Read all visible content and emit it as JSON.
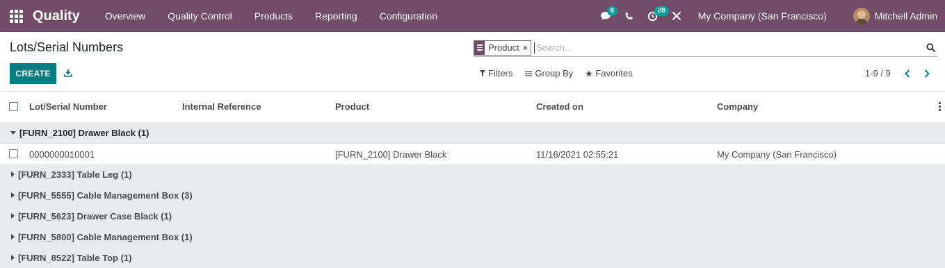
{
  "navbar": {
    "brand": "Quality",
    "menu": [
      "Overview",
      "Quality Control",
      "Products",
      "Reporting",
      "Configuration"
    ],
    "messages_count": "6",
    "activities_count": "28",
    "company": "My Company (San Francisco)",
    "user": "Mitchell Admin",
    "colors": {
      "navbar_bg": "#714b67",
      "badge": "#00a09d"
    }
  },
  "control_panel": {
    "title": "Lots/Serial Numbers",
    "create_label": "CREATE",
    "search": {
      "facet": "Product",
      "placeholder": "Search..."
    },
    "filters_label": "Filters",
    "group_by_label": "Group By",
    "favorites_label": "Favorites",
    "pager": "1-9 / 9",
    "colors": {
      "primary_button": "#017e84"
    }
  },
  "list": {
    "columns": [
      "Lot/Serial Number",
      "Internal Reference",
      "Product",
      "Created on",
      "Company"
    ],
    "groups": [
      {
        "label": "[FURN_2100] Drawer Black (1)",
        "expanded": true
      },
      {
        "label": "[FURN_2333] Table Leg (1)",
        "expanded": false
      },
      {
        "label": "[FURN_5555] Cable Management Box (3)",
        "expanded": false
      },
      {
        "label": "[FURN_5623] Drawer Case Black (1)",
        "expanded": false
      },
      {
        "label": "[FURN_5800] Cable Management Box (1)",
        "expanded": false
      },
      {
        "label": "[FURN_8522] Table Top (1)",
        "expanded": false
      }
    ],
    "record": {
      "lot": "0000000010001",
      "internal_reference": "",
      "product": "[FURN_2100] Drawer Black",
      "created_on": "11/16/2021 02:55:21",
      "company": "My Company (San Francisco)"
    }
  }
}
